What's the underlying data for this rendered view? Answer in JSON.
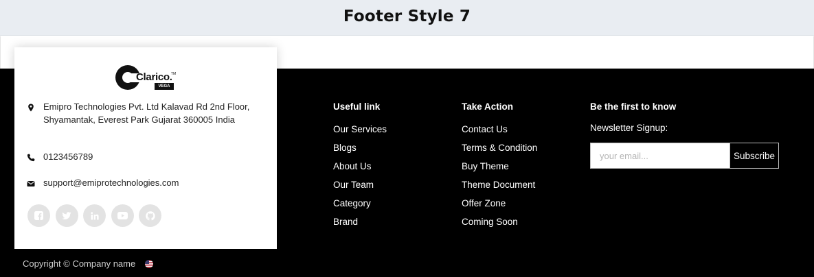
{
  "page_title": "Footer Style 7",
  "brand": {
    "logo_text": "Clarico.",
    "logo_tm": "TM",
    "logo_badge": "VEGA",
    "accent_color": "#000000"
  },
  "contact": {
    "address": "Emipro Technologies Pvt. Ltd Kalavad Rd 2nd Floor, Shyamantak, Everest Park Gujarat 360005 India",
    "phone": "0123456789",
    "email": "support@emiprotechnologies.com"
  },
  "socials": [
    {
      "icon": "facebook-icon"
    },
    {
      "icon": "twitter-icon"
    },
    {
      "icon": "linkedin-icon"
    },
    {
      "icon": "youtube-icon"
    },
    {
      "icon": "github-icon"
    }
  ],
  "useful_links": {
    "heading": "Useful link",
    "items": [
      "Our Services",
      "Blogs",
      "About Us",
      "Our Team",
      "Category",
      "Brand"
    ]
  },
  "take_action": {
    "heading": "Take Action",
    "items": [
      "Contact Us",
      "Terms & Condition",
      "Buy Theme",
      "Theme Document",
      "Offer Zone",
      "Coming Soon"
    ]
  },
  "newsletter": {
    "heading": "Be the first to know",
    "label": "Newsletter Signup:",
    "placeholder": "your email...",
    "value": "",
    "button": "Subscribe"
  },
  "copyright": "Copyright © Company name",
  "language_flag": "us-flag-icon"
}
